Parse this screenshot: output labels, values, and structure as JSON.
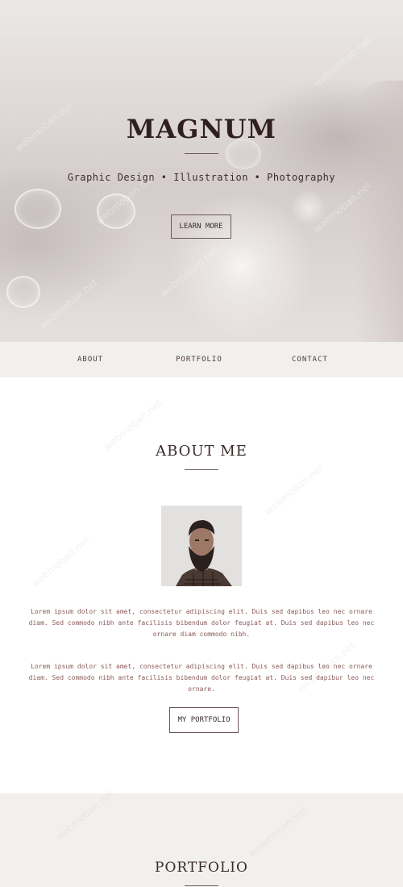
{
  "hero": {
    "title": "MAGNUM",
    "subtitle": "Graphic Design • Illustration • Photography",
    "button_label": "LEARN MORE"
  },
  "nav": {
    "items": [
      {
        "label": "ABOUT"
      },
      {
        "label": "PORTFOLIO"
      },
      {
        "label": "CONTACT"
      }
    ]
  },
  "about": {
    "title": "ABOUT ME",
    "paragraphs": [
      "Lorem ipsum dolor sit amet, consectetur adipiscing elit. Duis sed dapibus leo nec ornare diam. Sed commodo nibh ante facilisis bibendum dolor feugiat at. Duis sed dapibus leo nec ornare diam commodo nibh.",
      "Lorem ipsum dolor sit amet, consectetur adipiscing elit. Duis sed dapibus leo nec ornare diam. Sed commodo nibh ante facilisis bibendum dolor feugiat at. Duis sed dapibur leo nec ornare."
    ],
    "button_label": "MY PORTFOLIO"
  },
  "portfolio": {
    "title": "PORTFOLIO"
  },
  "watermark": {
    "text": "webmoban.net"
  },
  "colors": {
    "text_dark": "#3a2c2c",
    "paragraph": "#8a5a5a",
    "nav_bg": "#f2f0ef"
  }
}
